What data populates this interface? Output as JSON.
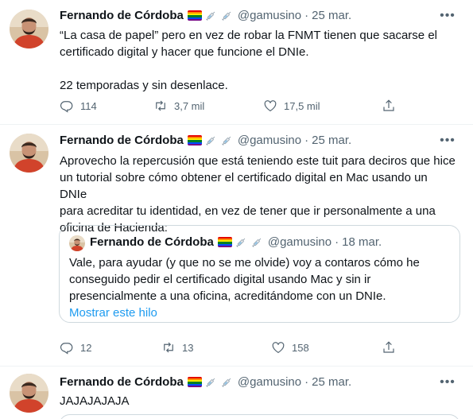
{
  "tweets": [
    {
      "author": "Fernando de Córdoba",
      "handle": "@gamusino",
      "separator": "·",
      "date": "25 mar.",
      "text": [
        "“La casa de papel” pero en vez de robar la FNMT tienen que sacarse el",
        "certificado digital y hacer que funcione el DNIe.",
        "",
        "22 temporadas y sin desenlace."
      ],
      "replies": "114",
      "retweets": "3,7 mil",
      "likes": "17,5 mil"
    },
    {
      "author": "Fernando de Córdoba",
      "handle": "@gamusino",
      "separator": "·",
      "date": "25 mar.",
      "text": [
        "Aprovecho la repercusión que está teniendo este tuit para deciros que hice",
        "un tutorial sobre cómo obtener el certificado digital en Mac usando un DNIe",
        "para acreditar tu identidad, en vez de tener que ir personalmente a una",
        "oficina de Hacienda:"
      ],
      "quote": {
        "author": "Fernando de Córdoba",
        "handle": "@gamusino",
        "separator": "·",
        "date": "18 mar.",
        "text": [
          "Vale, para ayudar (y que no se me olvide) voy a contaros cómo he",
          "conseguido pedir el certificado digital usando Mac y sin ir",
          "presencialmente a una oficina, acreditándome con un DNIe."
        ],
        "link": "Mostrar este hilo"
      },
      "replies": "12",
      "retweets": "13",
      "likes": "158"
    },
    {
      "author": "Fernando de Córdoba",
      "handle": "@gamusino",
      "separator": "·",
      "date": "25 mar.",
      "text": [
        "JAJAJAJAJA"
      ]
    }
  ],
  "icons": {
    "more": "more-dots-icon",
    "reply": "reply-icon",
    "retweet": "retweet-icon",
    "like": "heart-icon",
    "share": "share-icon",
    "flag": "rainbow-flag-icon",
    "syringe": "syringe-icon"
  },
  "colors": {
    "text": "#0f1419",
    "secondary": "#536471",
    "link": "#1d9bf0",
    "border": "#cfd9de",
    "thread_line": "#cfd9de"
  }
}
